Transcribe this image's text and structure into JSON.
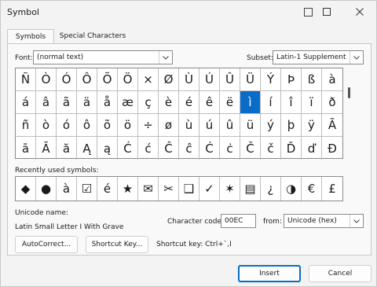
{
  "window": {
    "title": "Symbol"
  },
  "tabs": [
    {
      "label": "Symbols",
      "active": true
    },
    {
      "label": "Special Characters",
      "active": false
    }
  ],
  "font": {
    "label": "Font:",
    "value": "(normal text)"
  },
  "subset": {
    "label": "Subset:",
    "value": "Latin-1 Supplement"
  },
  "symbol_grid": {
    "rows": [
      [
        "Ñ",
        "Ò",
        "Ó",
        "Ô",
        "Õ",
        "Ö",
        "×",
        "Ø",
        "Ù",
        "Ú",
        "Û",
        "Ü",
        "Ý",
        "Þ",
        "ß",
        "à"
      ],
      [
        "á",
        "â",
        "ã",
        "ä",
        "å",
        "æ",
        "ç",
        "è",
        "é",
        "ê",
        "ë",
        "ì",
        "í",
        "î",
        "ï",
        "ð"
      ],
      [
        "ñ",
        "ò",
        "ó",
        "ô",
        "õ",
        "ö",
        "÷",
        "ø",
        "ù",
        "ú",
        "û",
        "ü",
        "ý",
        "þ",
        "ÿ",
        "Ā"
      ],
      [
        "ā",
        "Ă",
        "ă",
        "Ą",
        "ą",
        "Ć",
        "ć",
        "Ĉ",
        "ĉ",
        "Ċ",
        "ċ",
        "Č",
        "č",
        "Ď",
        "ď",
        "Đ"
      ]
    ],
    "selected": {
      "row": 1,
      "col": 11
    }
  },
  "recent": {
    "label": "Recently used symbols:",
    "symbols": [
      "◆",
      "●",
      "à",
      "☑",
      "é",
      "★",
      "✉",
      "✂",
      "❑",
      "✓",
      "✶",
      "▤",
      "¿",
      "◑",
      "€",
      "£"
    ]
  },
  "unicode": {
    "label": "Unicode name:",
    "name": "Latin Small Letter I With Grave"
  },
  "char_code": {
    "label": "Character code:",
    "value": "00EC"
  },
  "from": {
    "label": "from:",
    "value": "Unicode (hex)"
  },
  "buttons": {
    "autocorrect": "AutoCorrect...",
    "shortcut_key": "Shortcut Key...",
    "insert": "Insert",
    "cancel": "Cancel"
  },
  "shortcut": {
    "text": "Shortcut key: Ctrl+`,I"
  },
  "colors": {
    "accent": "#0a6cc9",
    "background": "#f3f3f3"
  }
}
